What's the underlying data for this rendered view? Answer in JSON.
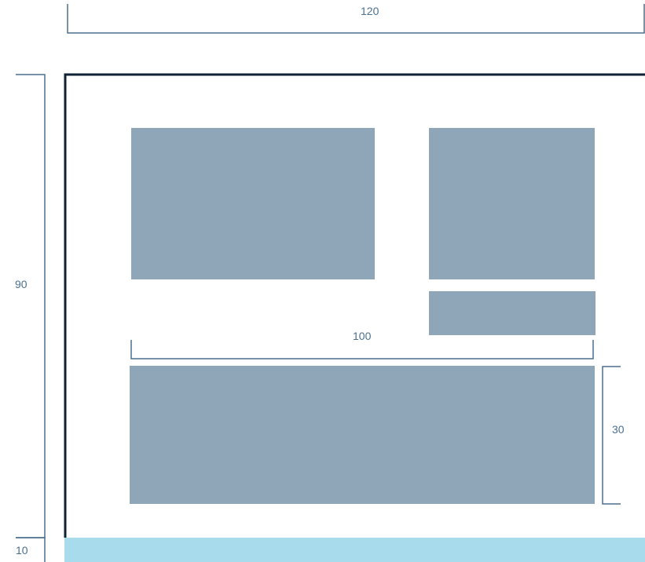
{
  "dimensions": {
    "top_width": "120",
    "left_height": "90",
    "bottom_height": "10",
    "inner_width": "100",
    "right_height": "30"
  },
  "colors": {
    "frame": "#0f2236",
    "dimension_line": "#4a6f8e",
    "block_fill": "#8fa5b8",
    "base_strip": "#a8dcec"
  }
}
